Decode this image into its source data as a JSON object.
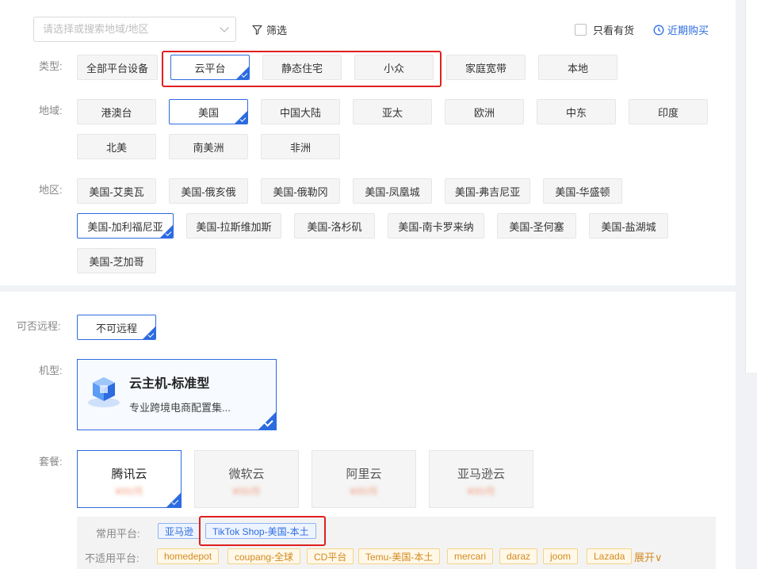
{
  "search": {
    "placeholder": "请选择或搜索地域/地区"
  },
  "filter_label": "筛选",
  "in_stock_label": "只看有货",
  "recent_purchase_label": "近期购买",
  "type": {
    "label": "类型:",
    "options": [
      "全部平台设备",
      "云平台",
      "静态住宅",
      "小众",
      "家庭宽带",
      "本地"
    ],
    "selected": "云平台"
  },
  "region": {
    "label": "地域:",
    "options": [
      "港澳台",
      "美国",
      "中国大陆",
      "亚太",
      "欧洲",
      "中东",
      "印度",
      "北美",
      "南美洲",
      "非洲"
    ],
    "selected": "美国"
  },
  "area": {
    "label": "地区:",
    "options": [
      "美国-艾奥瓦",
      "美国-俄亥俄",
      "美国-俄勒冈",
      "美国-凤凰城",
      "美国-弗吉尼亚",
      "美国-华盛顿",
      "美国-加利福尼亚",
      "美国-拉斯维加斯",
      "美国-洛杉矶",
      "美国-南卡罗来纳",
      "美国-圣何塞",
      "美国-盐湖城",
      "美国-芝加哥"
    ],
    "selected": "美国-加利福尼亚"
  },
  "remote": {
    "label": "可否远程:",
    "options": [
      "不可远程"
    ],
    "selected": "不可远程"
  },
  "machine": {
    "label": "机型:",
    "title": "云主机-标准型",
    "desc": "专业跨境电商配置集..."
  },
  "package": {
    "label": "套餐:",
    "options": [
      {
        "name": "腾讯云",
        "price": "¥00/月"
      },
      {
        "name": "微软云",
        "price": "¥00/月"
      },
      {
        "name": "阿里云",
        "price": "¥00/月"
      },
      {
        "name": "亚马逊云",
        "price": "¥00/月"
      }
    ],
    "selected": "腾讯云"
  },
  "platforms": {
    "common_label": "常用平台:",
    "common": [
      "亚马逊",
      "TikTok Shop-美国-本土"
    ],
    "unsuitable_label": "不适用平台:",
    "unsuitable": [
      "homedepot",
      "coupang-全球",
      "CD平台",
      "Temu-美国-本土",
      "mercari",
      "daraz",
      "joom",
      "Lazada"
    ],
    "expand_label": "展开∨"
  },
  "colors": {
    "accent": "#2c6be0",
    "highlight": "#e02020",
    "warning": "#d48a1f"
  }
}
